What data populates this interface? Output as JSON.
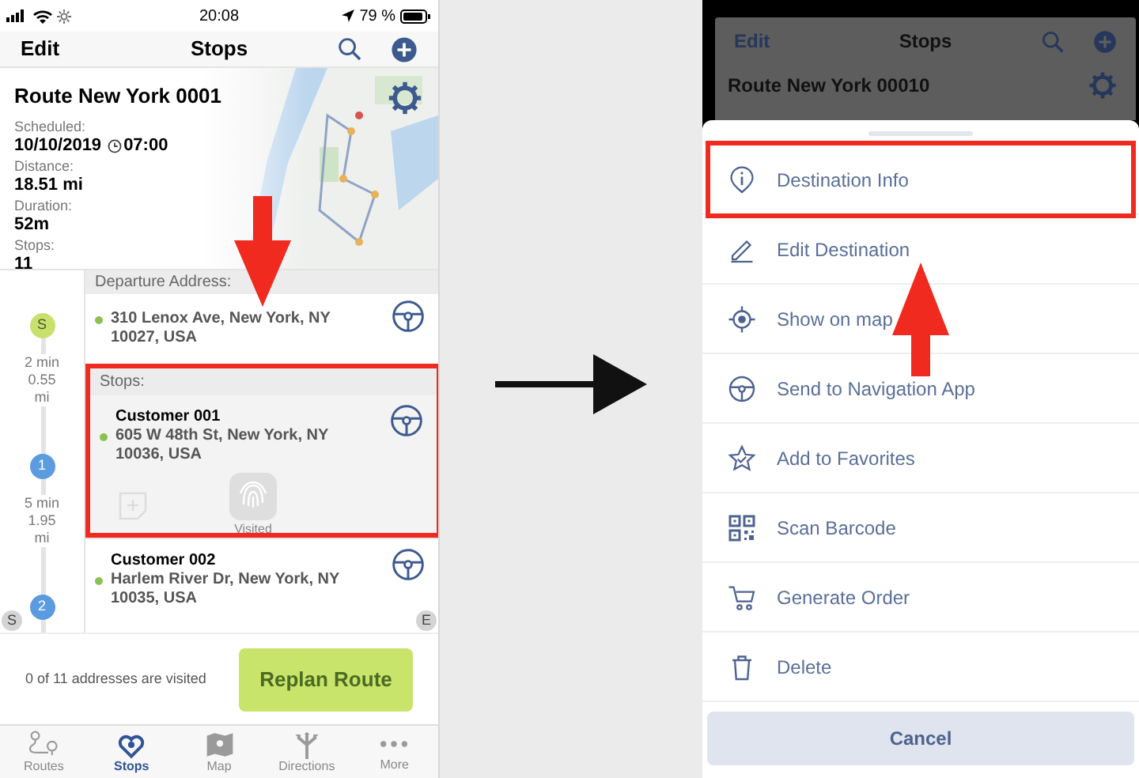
{
  "status_bar": {
    "time": "20:08",
    "battery": "79 %"
  },
  "nav": {
    "left": "Edit",
    "title": "Stops"
  },
  "route": {
    "name": "Route New York 0001",
    "fields": [
      {
        "label": "Scheduled:",
        "value": "10/10/2019",
        "time": "07:00"
      },
      {
        "label": "Distance:",
        "value": "18.51 mi"
      },
      {
        "label": "Duration:",
        "value": "52m"
      },
      {
        "label": "Stops:",
        "value": "11"
      }
    ]
  },
  "timeline": [
    {
      "kind": "marker",
      "label": "S",
      "color": "#c8e06c"
    },
    {
      "kind": "leg",
      "time": "2 min",
      "distance": [
        "0.55",
        "mi"
      ]
    },
    {
      "kind": "marker",
      "label": "1",
      "color": "#5b9be0"
    },
    {
      "kind": "leg",
      "time": "5 min",
      "distance": [
        "1.95",
        "mi"
      ]
    },
    {
      "kind": "marker",
      "label": "2",
      "color": "#5b9be0"
    }
  ],
  "route_ends": [
    "S",
    "E"
  ],
  "departure": {
    "header": "Departure Address:",
    "lines": [
      "310 Lenox Ave, New York, NY",
      "10027, USA"
    ]
  },
  "stops": {
    "header": "Stops:",
    "items": [
      {
        "name": "Customer 001",
        "lines": [
          "605 W 48th St, New York, NY",
          "10036, USA"
        ],
        "visited_label": "Visited",
        "selected": true
      },
      {
        "name": "Customer 002",
        "lines": [
          "Harlem River Dr, New York, NY",
          "10035, USA"
        ],
        "selected": false
      }
    ]
  },
  "footer": {
    "summary": "0 of 11 addresses are visited",
    "button": "Replan Route"
  },
  "tabs": [
    {
      "label": "Routes",
      "selected": false
    },
    {
      "label": "Stops",
      "selected": true
    },
    {
      "label": "Map",
      "selected": false
    },
    {
      "label": "Directions",
      "selected": false
    },
    {
      "label": "More",
      "selected": false
    }
  ],
  "sheet": {
    "behind": {
      "left": "Edit",
      "title": "Stops",
      "route": "Route New York 00010"
    },
    "items": [
      {
        "label": "Destination Info"
      },
      {
        "label": "Edit Destination"
      },
      {
        "label": "Show on map"
      },
      {
        "label": "Send to Navigation App"
      },
      {
        "label": "Add to Favorites"
      },
      {
        "label": "Scan Barcode"
      },
      {
        "label": "Generate Order"
      },
      {
        "label": "Delete"
      }
    ],
    "cancel": "Cancel"
  }
}
